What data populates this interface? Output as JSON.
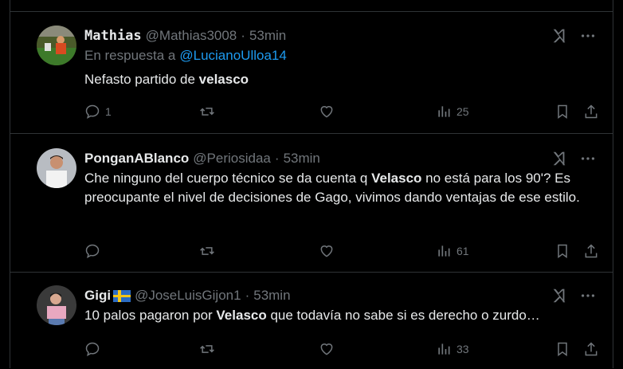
{
  "tweets": [
    {
      "name": "Mathias",
      "handle": "@Mathias3008",
      "dot": "·",
      "time": "53min",
      "reply_prefix": "En respuesta a",
      "reply_to": "@LucianoUlloa14",
      "text_before": "Nefasto partido de ",
      "text_bold": "velasco",
      "text_after": "",
      "replies": "1",
      "views": "25",
      "avatar_color": "#6b7a3a"
    },
    {
      "name": "PonganABlanco",
      "handle": "@Periosidaa",
      "dot": "·",
      "time": "53min",
      "text_before": "Che ninguno del cuerpo técnico se da cuenta q ",
      "text_bold": "Velasco",
      "text_after": " no está para los 90'? Es preocupante el nivel de decisiones de Gago, vivimos dando ventajas de ese estilo.",
      "replies": "",
      "views": "61",
      "avatar_color": "#8a8f97"
    },
    {
      "name": "Gigi",
      "flag": "Sweden flag",
      "handle": "@JoseLuisGijon1",
      "dot": "·",
      "time": "53min",
      "text_before": "10 palos pagaron por ",
      "text_bold": "Velasco",
      "text_after": " que todavía no sabe si es derecho o zurdo…",
      "replies": "",
      "views": "33",
      "avatar_color": "#c78fa0"
    }
  ],
  "colors": {
    "background": "#000000",
    "text": "#e7e9ea",
    "muted": "#71767b",
    "link": "#1d9bf0",
    "border": "#2f3336"
  },
  "icons": [
    "reply-icon",
    "retweet-icon",
    "like-icon",
    "views-icon",
    "bookmark-icon",
    "share-icon",
    "grok-icon",
    "more-icon"
  ]
}
